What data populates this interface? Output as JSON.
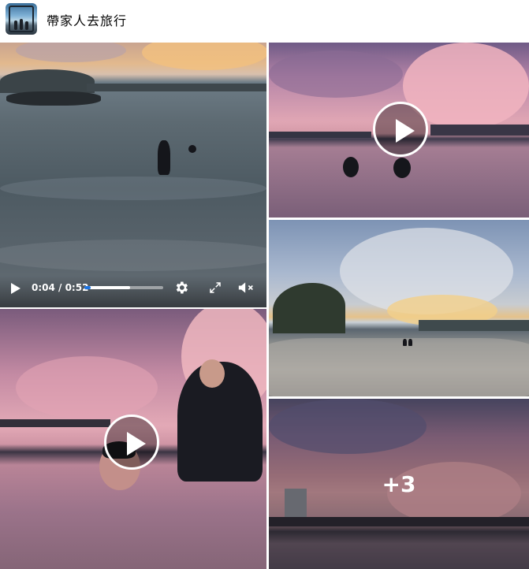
{
  "header": {
    "page_name": "帶家人去旅行",
    "avatar_icon": "profile-avatar"
  },
  "video1": {
    "current_time": "0:04",
    "duration": "0:52",
    "time_display": "0:04 / 0:52",
    "progress_played_fraction": 0.08,
    "progress_buffered_fraction": 0.58,
    "icons": [
      "play-icon",
      "gear-icon",
      "fullscreen-icon",
      "volume-muted-icon"
    ]
  },
  "grid": {
    "more_count": "+3",
    "play_icon": "play-icon"
  },
  "colors": {
    "progress_played": "#1b74e4",
    "page_name_text": "#050505",
    "background": "#ffffff"
  }
}
